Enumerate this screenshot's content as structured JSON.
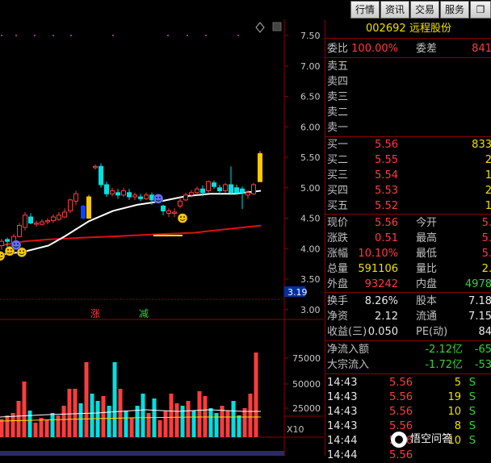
{
  "toolbar": {
    "buttons": [
      "行情",
      "资讯",
      "交易",
      "服务"
    ]
  },
  "price_axis": {
    "labels": [
      "7.50",
      "7.00",
      "6.50",
      "6.00",
      "5.50",
      "5.00",
      "4.50",
      "4.00",
      "3.50",
      "3.00"
    ],
    "current_marker": "3.19"
  },
  "chart_markers": {
    "rise": "涨",
    "fall": "减"
  },
  "volume_axis": {
    "labels": [
      "75000",
      "50000",
      "25000"
    ],
    "unit": "X10"
  },
  "stock": {
    "code": "002692",
    "name": "远程股份"
  },
  "order_ratio": {
    "label1": "委比",
    "value1": "100.00%",
    "label2": "委差",
    "value2": "841"
  },
  "sell_orders": [
    {
      "label": "卖五",
      "price": "",
      "volume": ""
    },
    {
      "label": "卖四",
      "price": "",
      "volume": ""
    },
    {
      "label": "卖三",
      "price": "",
      "volume": ""
    },
    {
      "label": "卖二",
      "price": "",
      "volume": ""
    },
    {
      "label": "卖一",
      "price": "",
      "volume": ""
    }
  ],
  "buy_orders": [
    {
      "label": "买一",
      "price": "5.56",
      "volume": "833"
    },
    {
      "label": "买二",
      "price": "5.55",
      "volume": "2"
    },
    {
      "label": "买三",
      "price": "5.54",
      "volume": "1"
    },
    {
      "label": "买四",
      "price": "5.53",
      "volume": "2"
    },
    {
      "label": "买五",
      "price": "5.52",
      "volume": "1"
    }
  ],
  "quote": [
    {
      "l1": "现价",
      "v1": "5.56",
      "l2": "今开",
      "v2": "5."
    },
    {
      "l1": "涨跌",
      "v1": "0.51",
      "l2": "最高",
      "v2": "5."
    },
    {
      "l1": "涨幅",
      "v1": "10.10%",
      "l2": "最低",
      "v2": "5."
    },
    {
      "l1": "总量",
      "v1": "591106",
      "l2": "量比",
      "v2": "2."
    },
    {
      "l1": "外盘",
      "v1": "93242",
      "l2": "内盘",
      "v2": "4978"
    }
  ],
  "fundamentals": [
    {
      "l1": "换手",
      "v1": "8.26%",
      "l2": "股本",
      "v2": "7.18"
    },
    {
      "l1": "净资",
      "v1": "2.12",
      "l2": "流通",
      "v2": "7.15"
    },
    {
      "l1": "收益(三)",
      "v1": "0.050",
      "l2": "PE(动)",
      "v2": "84"
    }
  ],
  "flows": [
    {
      "label": "净流入额",
      "v1": "-2.12亿",
      "v2": "-65"
    },
    {
      "label": "大宗流入",
      "v1": "-1.72亿",
      "v2": "-53"
    }
  ],
  "ticks": [
    {
      "time": "14:43",
      "price": "5.56",
      "vol": "5",
      "side": "S"
    },
    {
      "time": "14:43",
      "price": "5.56",
      "vol": "19",
      "side": "S"
    },
    {
      "time": "14:43",
      "price": "5.56",
      "vol": "10",
      "side": "S"
    },
    {
      "time": "14:43",
      "price": "5.56",
      "vol": "8",
      "side": "S"
    },
    {
      "time": "14:44",
      "price": "5.56",
      "vol": "10",
      "side": "S"
    },
    {
      "time": "14:44",
      "price": "5.56",
      "vol": "",
      "side": ""
    }
  ],
  "watermark": "悟空问答",
  "colors": {
    "up": "#ff3c3c",
    "down": "#00ffff",
    "ma_white": "#ffffff",
    "ma_red": "#e01010",
    "axis_red": "#8b0000",
    "highlight_yellow": "#ffc800"
  }
}
